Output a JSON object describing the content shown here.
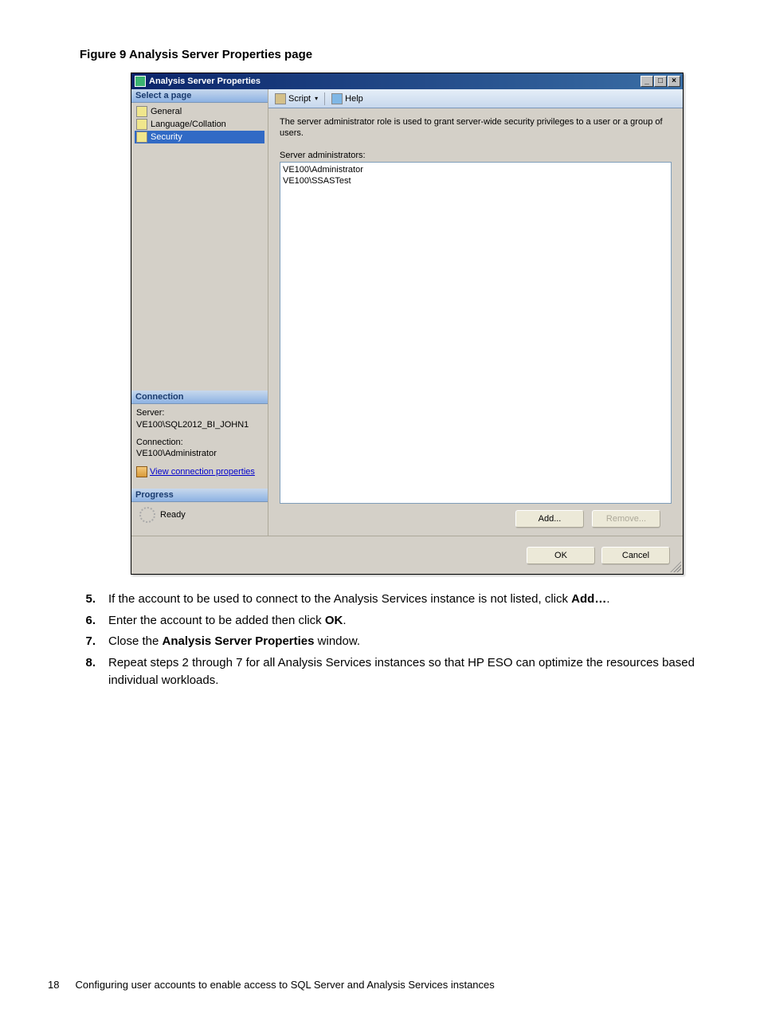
{
  "figure_caption": "Figure 9 Analysis Server Properties page",
  "window": {
    "title": "Analysis Server Properties",
    "controls": {
      "min": "_",
      "max": "□",
      "close": "×"
    }
  },
  "sidebar": {
    "select_header": "Select a page",
    "pages": [
      {
        "label": "General",
        "selected": false
      },
      {
        "label": "Language/Collation",
        "selected": false
      },
      {
        "label": "Security",
        "selected": true
      }
    ],
    "connection_header": "Connection",
    "server_label": "Server:",
    "server_value": "VE100\\SQL2012_BI_JOHN1",
    "connection_label": "Connection:",
    "connection_value": "VE100\\Administrator",
    "view_conn_link": "View connection properties",
    "progress_header": "Progress",
    "progress_status": "Ready"
  },
  "toolbar": {
    "script": "Script",
    "help": "Help"
  },
  "main": {
    "description": "The server administrator role is used to grant server-wide security privileges to a user or a group of users.",
    "list_label": "Server administrators:",
    "admins": [
      "VE100\\Administrator",
      "VE100\\SSASTest"
    ],
    "add_btn": "Add...",
    "remove_btn": "Remove..."
  },
  "footer": {
    "ok": "OK",
    "cancel": "Cancel"
  },
  "instructions": [
    {
      "num": "5.",
      "pre": "If the account to be used to connect to the Analysis Services instance is not listed, click ",
      "bold": "Add…",
      "post": "."
    },
    {
      "num": "6.",
      "pre": "Enter the account to be added then click ",
      "bold": "OK",
      "post": "."
    },
    {
      "num": "7.",
      "pre": "Close the ",
      "bold": "Analysis Server Properties",
      "post": " window."
    },
    {
      "num": "8.",
      "pre": "Repeat steps 2 through 7 for all Analysis Services instances so that HP ESO can optimize the resources based individual workloads.",
      "bold": "",
      "post": ""
    }
  ],
  "page_footer": {
    "number": "18",
    "title": "Configuring user accounts to enable access to SQL Server and Analysis Services instances"
  }
}
